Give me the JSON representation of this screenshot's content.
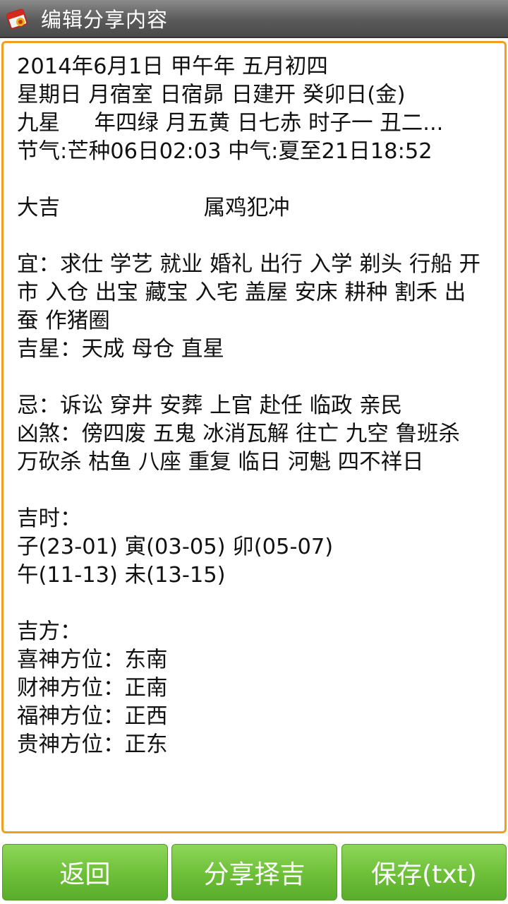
{
  "titlebar": {
    "title": "编辑分享内容",
    "icon": "calendar-app-icon"
  },
  "editor": {
    "text": "2014年6月1日 甲午年 五月初四\n星期日 月宿室 日宿昴 日建开 癸卯日(金)\n九星     年四绿 月五黄 日七赤 时子一 丑二...\n节气:芒种06日02:03 中气:夏至21日18:52\n\n大吉                     属鸡犯冲\n\n宜：求仕 学艺 就业 婚礼 出行 入学 剃头 行船 开\n市 入仓 出宝 藏宝 入宅 盖屋 安床 耕种 割禾 出\n蚕 作猪圈\n吉星：天成 母仓 直星\n\n忌：诉讼 穿井 安葬 上官 赴任 临政 亲民\n凶煞：傍四废 五鬼 冰消瓦解 往亡 九空 鲁班杀\n万砍杀 枯鱼 八座 重复 临日 河魁 四不祥日\n\n吉时：\n子(23-01) 寅(03-05) 卯(05-07)\n午(11-13) 未(13-15)\n\n吉方：\n喜神方位：东南\n财神方位：正南\n福神方位：正西\n贵神方位：正东"
  },
  "buttons": {
    "back": "返回",
    "share": "分享择吉",
    "save": "保存(txt)"
  },
  "colors": {
    "accent_border": "#f0a020",
    "button_green": "#6fc13a",
    "titlebar_gray": "#5a5a5a"
  }
}
